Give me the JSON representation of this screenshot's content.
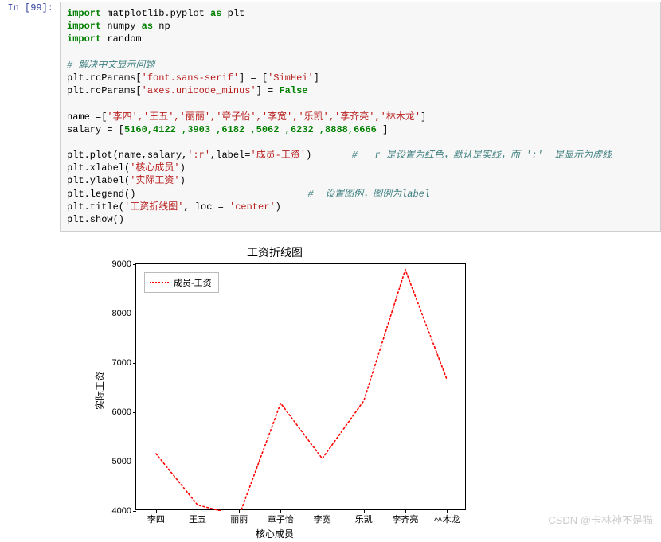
{
  "prompt": "In  [99]:",
  "code": {
    "l1": {
      "kw": "import",
      "mod": "matplotlib.pyplot",
      "as": "as",
      "alias": "plt"
    },
    "l2": {
      "kw": "import",
      "mod": "numpy",
      "as": "as",
      "alias": "np"
    },
    "l3": {
      "kw": "import",
      "mod": "random"
    },
    "c1": "# 解决中文显示问题",
    "l4a": "plt.rcParams[",
    "l4s": "'font.sans-serif'",
    "l4b": "] = [",
    "l4c": "'SimHei'",
    "l4d": "]",
    "l5a": "plt.rcParams[",
    "l5s": "'axes.unicode_minus'",
    "l5b": "] = ",
    "l5c": "False",
    "l6a": "name =[",
    "l6names": "'李四','王五','丽丽','章子怡','李宽','乐凯','李齐亮','林木龙'",
    "l6b": "]",
    "l7a": "salary = [",
    "l7v": "5160,4122 ,3903 ,6182 ,5062 ,6232 ,8888,6666 ",
    "l7b": "]",
    "l8a": "plt.plot(name,salary,",
    "l8s1": "':r'",
    "l8b": ",label=",
    "l8s2": "'成员-工资'",
    "l8c": ")",
    "c2": "#   r 是设置为红色，默认是实线，而 ':'  是显示为虚线",
    "l9a": "plt.xlabel(",
    "l9s": "'核心成员'",
    "l9b": ")",
    "l10a": "plt.ylabel(",
    "l10s": "'实际工资'",
    "l10b": ")",
    "l11a": "plt.legend()",
    "c3": "#  设置图例，图例为label",
    "l12a": "plt.title(",
    "l12s": "'工资折线图'",
    "l12b": ", loc = ",
    "l12s2": "'center'",
    "l12c": ")",
    "l13": "plt.show()"
  },
  "chart_data": {
    "type": "line",
    "title": "工资折线图",
    "xlabel": "核心成员",
    "ylabel": "实际工资",
    "categories": [
      "李四",
      "王五",
      "丽丽",
      "章子怡",
      "李宽",
      "乐凯",
      "李齐亮",
      "林木龙"
    ],
    "values": [
      5160,
      4122,
      3903,
      6182,
      5062,
      6232,
      8888,
      6666
    ],
    "ylim": [
      4000,
      9000
    ],
    "yticks": [
      4000,
      5000,
      6000,
      7000,
      8000,
      9000
    ],
    "legend": "成员-工资",
    "line_style": "dotted",
    "line_color": "#ff0000"
  },
  "watermark": "CSDN @卡林神不是猫"
}
